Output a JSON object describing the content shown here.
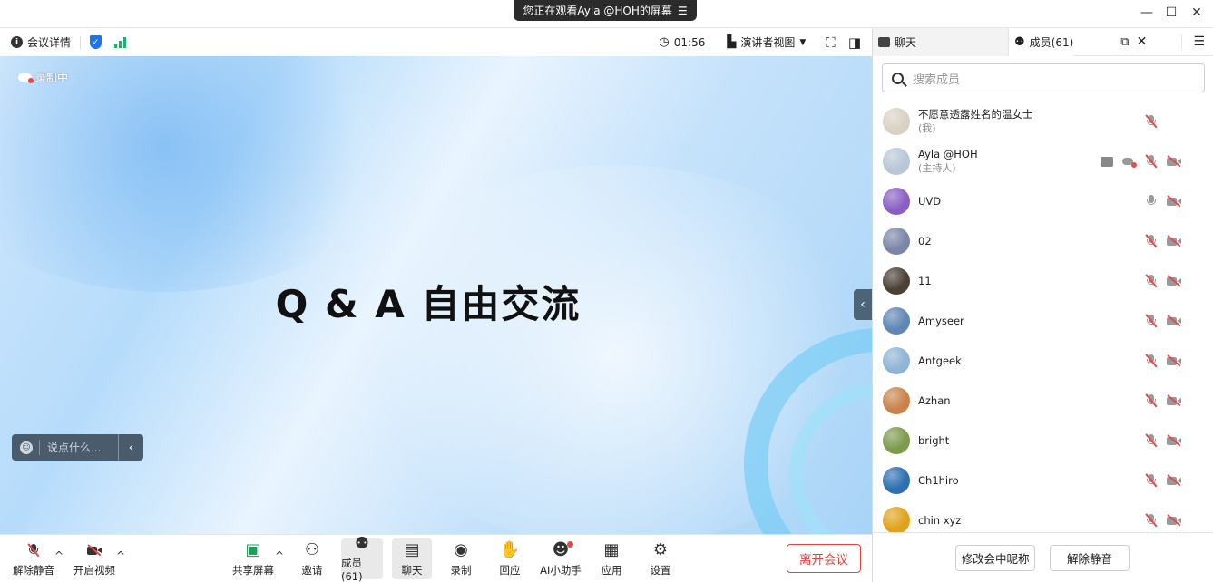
{
  "window": {
    "banner_text": "您正在观看Ayla @HOH的屏幕",
    "banner_menu_icon": "menu-icon",
    "controls": [
      "minimize-icon",
      "maximize-icon",
      "close-icon"
    ]
  },
  "toolbar": {
    "meeting_details": "会议详情",
    "timer": "01:56",
    "view_mode": "演讲者视图"
  },
  "stage": {
    "recording_label": "录制中",
    "title": "Q & A 自由交流",
    "chat_placeholder": "说点什么..."
  },
  "bottom": {
    "unmute": "解除静音",
    "start_video": "开启视频",
    "share_screen": "共享屏幕",
    "invite": "邀请",
    "members": "成员(61)",
    "chat": "聊天",
    "record": "录制",
    "react": "回应",
    "ai_assistant": "AI小助手",
    "apps": "应用",
    "settings": "设置",
    "leave": "离开会议"
  },
  "panel": {
    "tab_chat": "聊天",
    "tab_members": "成员(61)",
    "search_placeholder": "搜索成员",
    "members": [
      {
        "name": "不愿意透露姓名的温女士",
        "role": "(我)",
        "mic": "off",
        "cam": "none",
        "avatar_color": "#d9d1c4"
      },
      {
        "name": "Ayla @HOH",
        "role": "(主持人)",
        "mic": "off",
        "cam": "off",
        "avatar_color": "#b9c6d6"
      },
      {
        "name": "UVD",
        "role": "",
        "mic": "on",
        "cam": "off",
        "avatar_color": "#8a5fc4"
      },
      {
        "name": "02",
        "role": "",
        "mic": "off",
        "cam": "off",
        "avatar_color": "#7b86a8"
      },
      {
        "name": "11",
        "role": "",
        "mic": "off",
        "cam": "off",
        "avatar_color": "#4a4034"
      },
      {
        "name": "Amyseer",
        "role": "",
        "mic": "off",
        "cam": "off",
        "avatar_color": "#5f86b5"
      },
      {
        "name": "Antgeek",
        "role": "",
        "mic": "off",
        "cam": "off",
        "avatar_color": "#8fb4d6"
      },
      {
        "name": "Azhan",
        "role": "",
        "mic": "off",
        "cam": "off",
        "avatar_color": "#c9834a"
      },
      {
        "name": "bright",
        "role": "",
        "mic": "off",
        "cam": "off",
        "avatar_color": "#7d9a4d"
      },
      {
        "name": "Ch1hiro",
        "role": "",
        "mic": "off",
        "cam": "off",
        "avatar_color": "#2d6fb0"
      },
      {
        "name": "chin xyz",
        "role": "",
        "mic": "off",
        "cam": "off",
        "avatar_color": "#e0a21d"
      }
    ],
    "rename_button": "修改会中昵称",
    "unmute_button": "解除静音"
  }
}
